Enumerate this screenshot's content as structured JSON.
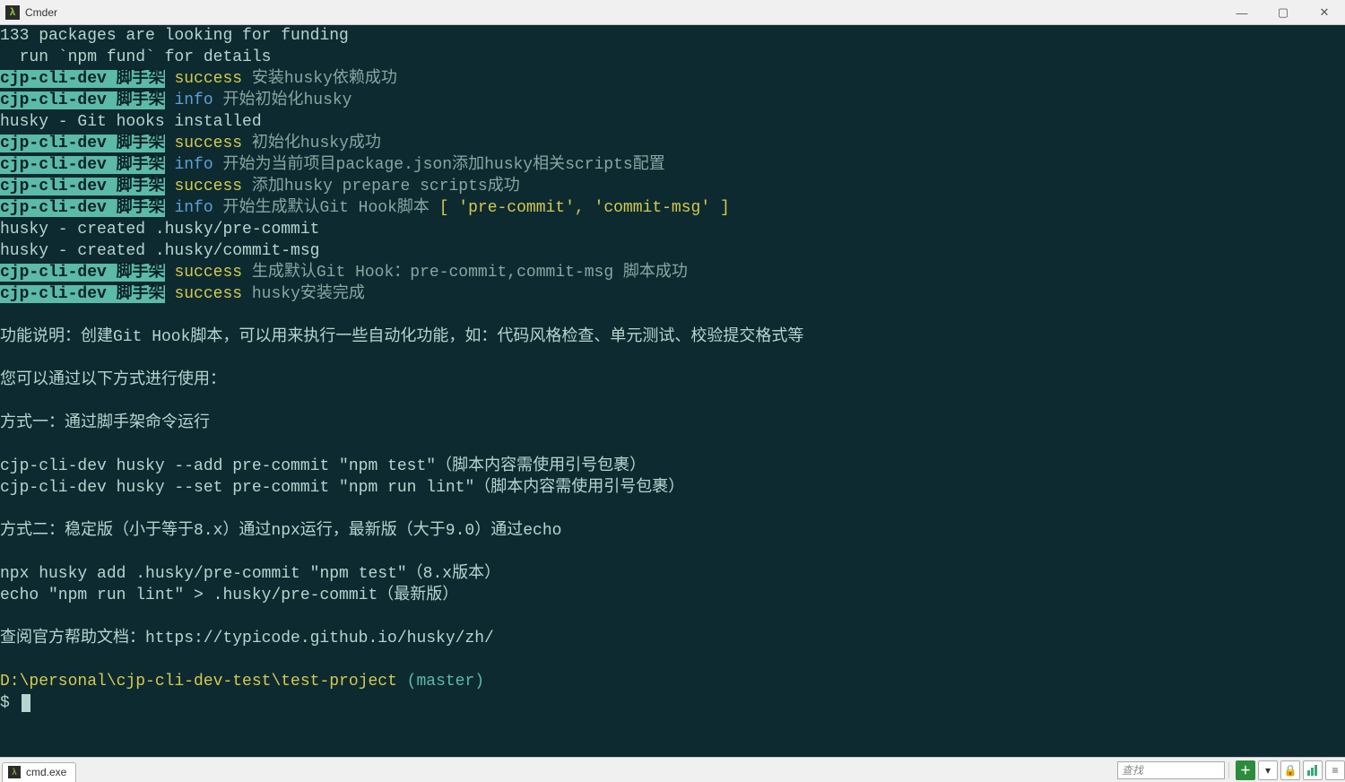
{
  "titlebar": {
    "title": "Cmder"
  },
  "win_controls": {
    "min": "—",
    "max": "▢",
    "close": "✕"
  },
  "terminal": {
    "lines": [
      {
        "kind": "plain",
        "text": "133 packages are looking for funding"
      },
      {
        "kind": "plain",
        "text": "  run `npm fund` for details"
      },
      {
        "kind": "tagged",
        "tag": "cjp-cli-dev 脚手架",
        "level": "success",
        "msg": "安装husky依赖成功"
      },
      {
        "kind": "tagged",
        "tag": "cjp-cli-dev 脚手架",
        "level": "info",
        "msg": "开始初始化husky"
      },
      {
        "kind": "plain",
        "text": "husky - Git hooks installed"
      },
      {
        "kind": "tagged",
        "tag": "cjp-cli-dev 脚手架",
        "level": "success",
        "msg": "初始化husky成功"
      },
      {
        "kind": "tagged",
        "tag": "cjp-cli-dev 脚手架",
        "level": "info",
        "msg": "开始为当前项目package.json添加husky相关scripts配置"
      },
      {
        "kind": "tagged",
        "tag": "cjp-cli-dev 脚手架",
        "level": "success",
        "msg": "添加husky prepare scripts成功"
      },
      {
        "kind": "tagged",
        "tag": "cjp-cli-dev 脚手架",
        "level": "info",
        "msg": "开始生成默认Git Hook脚本 ",
        "extra": "[ 'pre-commit', 'commit-msg' ]"
      },
      {
        "kind": "plain",
        "text": "husky - created .husky/pre-commit"
      },
      {
        "kind": "plain",
        "text": "husky - created .husky/commit-msg"
      },
      {
        "kind": "tagged",
        "tag": "cjp-cli-dev 脚手架",
        "level": "success",
        "msg": "生成默认Git Hook：pre-commit,commit-msg 脚本成功"
      },
      {
        "kind": "tagged",
        "tag": "cjp-cli-dev 脚手架",
        "level": "success",
        "msg": "husky安装完成"
      },
      {
        "kind": "blank",
        "text": ""
      },
      {
        "kind": "plain",
        "text": "功能说明：创建Git Hook脚本，可以用来执行一些自动化功能，如：代码风格检查、单元测试、校验提交格式等"
      },
      {
        "kind": "blank",
        "text": ""
      },
      {
        "kind": "plain",
        "text": "您可以通过以下方式进行使用："
      },
      {
        "kind": "blank",
        "text": ""
      },
      {
        "kind": "plain",
        "text": "方式一：通过脚手架命令运行"
      },
      {
        "kind": "blank",
        "text": ""
      },
      {
        "kind": "plain",
        "text": "cjp-cli-dev husky --add pre-commit \"npm test\"（脚本内容需使用引号包裹）"
      },
      {
        "kind": "plain",
        "text": "cjp-cli-dev husky --set pre-commit \"npm run lint\"（脚本内容需使用引号包裹）"
      },
      {
        "kind": "blank",
        "text": ""
      },
      {
        "kind": "plain",
        "text": "方式二：稳定版（小于等于8.x）通过npx运行，最新版（大于9.0）通过echo"
      },
      {
        "kind": "blank",
        "text": ""
      },
      {
        "kind": "plain",
        "text": "npx husky add .husky/pre-commit \"npm test\"（8.x版本）"
      },
      {
        "kind": "plain",
        "text": "echo \"npm run lint\" > .husky/pre-commit（最新版）"
      },
      {
        "kind": "blank",
        "text": ""
      },
      {
        "kind": "plain",
        "text": "查阅官方帮助文档：https://typicode.github.io/husky/zh/"
      },
      {
        "kind": "blank",
        "text": ""
      }
    ],
    "prompt": {
      "path": "D:\\personal\\cjp-cli-dev-test\\test-project",
      "branch": " (master)",
      "symbol": "$"
    }
  },
  "statusbar": {
    "tab_label": "cmd.exe",
    "search_placeholder": "查找"
  }
}
